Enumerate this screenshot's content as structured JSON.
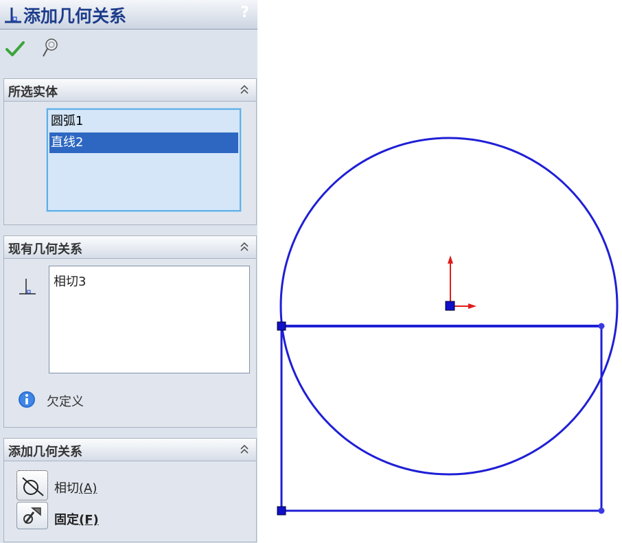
{
  "panel": {
    "title": "添加几何关系",
    "help_label": "?",
    "icons": {
      "title": "perpendicular-relation-icon",
      "ok": "checkmark-icon",
      "pin": "pushpin-icon"
    }
  },
  "selected_entities": {
    "header": "所选实体",
    "items": [
      "圆弧1",
      "直线2"
    ],
    "selected_index": 1
  },
  "existing_relations": {
    "header": "现有几何关系",
    "items": [
      "相切3"
    ],
    "status": "欠定义",
    "status_icon": "info-icon"
  },
  "add_relations": {
    "header": "添加几何关系",
    "buttons": [
      {
        "label": "相切",
        "accelerator": "(A)",
        "icon": "tangent-icon"
      },
      {
        "label": "固定",
        "accelerator": "(F)",
        "icon": "fix-icon"
      }
    ]
  },
  "colors": {
    "sketch": "#1f1fd6",
    "origin_axis": "#e01b1b",
    "selection": "#2d67c2"
  }
}
